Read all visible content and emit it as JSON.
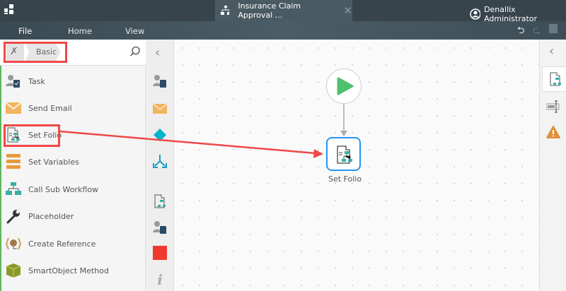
{
  "header": {
    "tab_title": "Insurance Claim Approval ...",
    "user": "Denallix Administrator"
  },
  "menu": [
    "File",
    "Home",
    "View"
  ],
  "toolbox": {
    "breadcrumb": "Basic",
    "items": [
      {
        "label": "Task",
        "icon": "task-icon"
      },
      {
        "label": "Send Email",
        "icon": "email-icon"
      },
      {
        "label": "Set Folio",
        "icon": "set-folio-icon"
      },
      {
        "label": "Set Variables",
        "icon": "set-variables-icon"
      },
      {
        "label": "Call Sub Workflow",
        "icon": "sub-workflow-icon"
      },
      {
        "label": "Placeholder",
        "icon": "wrench-icon"
      },
      {
        "label": "Create Reference",
        "icon": "create-reference-icon"
      },
      {
        "label": "SmartObject Method",
        "icon": "smartobject-icon"
      }
    ]
  },
  "canvas": {
    "node_label": "Set Folio"
  },
  "colors": {
    "annotation": "#f04848",
    "accent": "#2196f3",
    "start": "#4fc06f"
  }
}
